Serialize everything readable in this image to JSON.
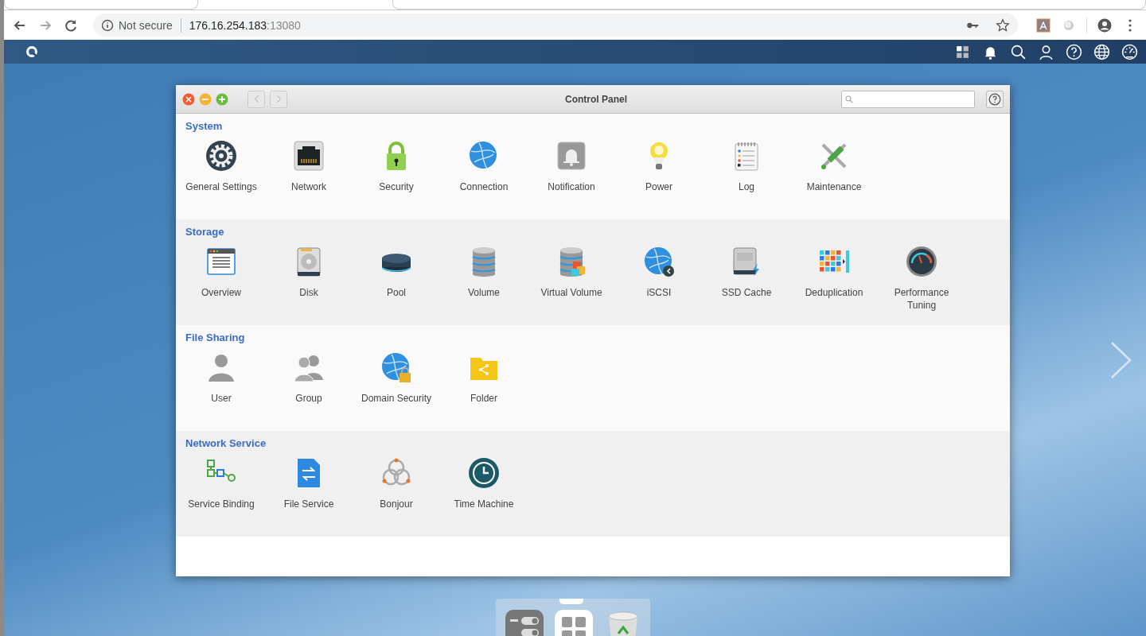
{
  "browser": {
    "security_label": "Not secure",
    "url_host": "176.16.254.183",
    "url_port": ":13080"
  },
  "window": {
    "title": "Control Panel"
  },
  "sections": [
    {
      "title": "System",
      "items": [
        {
          "label": "General Settings"
        },
        {
          "label": "Network"
        },
        {
          "label": "Security"
        },
        {
          "label": "Connection"
        },
        {
          "label": "Notification"
        },
        {
          "label": "Power"
        },
        {
          "label": "Log"
        },
        {
          "label": "Maintenance"
        }
      ]
    },
    {
      "title": "Storage",
      "items": [
        {
          "label": "Overview"
        },
        {
          "label": "Disk"
        },
        {
          "label": "Pool"
        },
        {
          "label": "Volume"
        },
        {
          "label": "Virtual Volume"
        },
        {
          "label": "iSCSI"
        },
        {
          "label": "SSD Cache"
        },
        {
          "label": "Deduplication"
        },
        {
          "label": "Performance Tuning"
        }
      ]
    },
    {
      "title": "File Sharing",
      "items": [
        {
          "label": "User"
        },
        {
          "label": "Group"
        },
        {
          "label": "Domain Security"
        },
        {
          "label": "Folder"
        }
      ]
    },
    {
      "title": "Network Service",
      "items": [
        {
          "label": "Service Binding"
        },
        {
          "label": "File Service"
        },
        {
          "label": "Bonjour"
        },
        {
          "label": "Time Machine"
        }
      ]
    }
  ]
}
